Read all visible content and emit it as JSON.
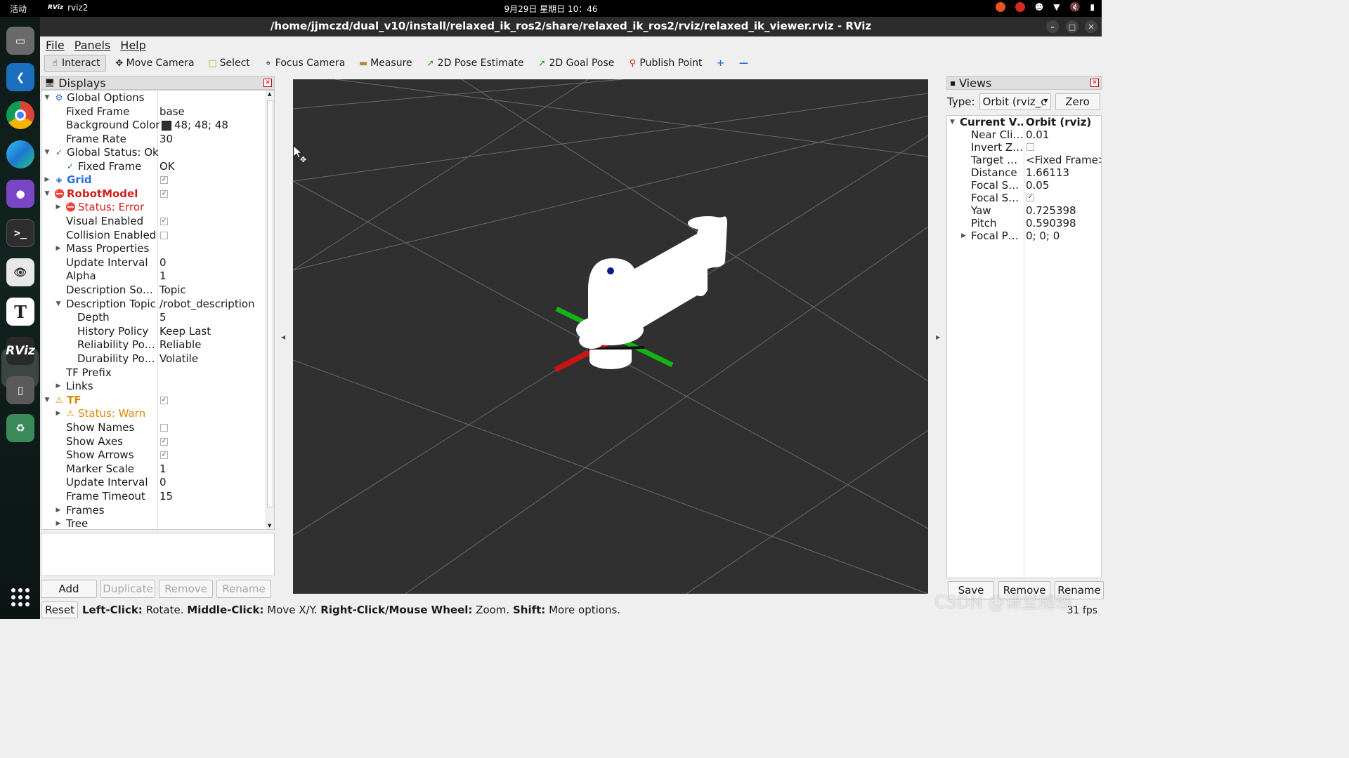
{
  "topbar": {
    "activities": "活动",
    "app_name": "rviz2",
    "app_logo": "RViz",
    "clock": "9月29日 星期日 10：46",
    "tray_icons": [
      "ubuntu-pro-icon",
      "weibo-icon",
      "accessibility-icon",
      "wifi-icon",
      "volume-muted-icon",
      "battery-icon"
    ]
  },
  "dock": {
    "apps": [
      "files-icon",
      "vscode-icon",
      "chrome-icon",
      "edge-icon",
      "github-desktop-icon",
      "terminal-icon",
      "document-viewer-icon",
      "typora-icon",
      "rviz-icon",
      "usb-drive-icon",
      "trash-icon"
    ],
    "rviz_label": "RViz",
    "typora_label": "T"
  },
  "window": {
    "title": "/home/jjmczd/dual_v10/install/relaxed_ik_ros2/share/relaxed_ik_ros2/rviz/relaxed_ik_viewer.rviz - RViz"
  },
  "menu": {
    "file": "File",
    "panels": "Panels",
    "help": "Help"
  },
  "toolbar": {
    "interact": "Interact",
    "move_camera": "Move Camera",
    "select": "Select",
    "focus_camera": "Focus Camera",
    "measure": "Measure",
    "pose_estimate": "2D Pose Estimate",
    "goal_pose": "2D Goal Pose",
    "publish_point": "Publish Point"
  },
  "displays": {
    "title": "Displays",
    "rows": [
      {
        "name": "Global Options",
        "value": ""
      },
      {
        "name": "Fixed Frame",
        "value": "base"
      },
      {
        "name": "Background Color",
        "value": "48; 48; 48"
      },
      {
        "name": "Frame Rate",
        "value": "30"
      },
      {
        "name": "Global Status: Ok",
        "value": ""
      },
      {
        "name": "Fixed Frame",
        "value": "OK"
      },
      {
        "name": "Grid",
        "value": ""
      },
      {
        "name": "RobotModel",
        "value": ""
      },
      {
        "name": "Status: Error",
        "value": ""
      },
      {
        "name": "Visual Enabled",
        "value": ""
      },
      {
        "name": "Collision Enabled",
        "value": ""
      },
      {
        "name": "Mass Properties",
        "value": ""
      },
      {
        "name": "Update Interval",
        "value": "0"
      },
      {
        "name": "Alpha",
        "value": "1"
      },
      {
        "name": "Description Sou…",
        "value": "Topic"
      },
      {
        "name": "Description Topic",
        "value": "/robot_description"
      },
      {
        "name": "Depth",
        "value": "5"
      },
      {
        "name": "History Policy",
        "value": "Keep Last"
      },
      {
        "name": "Reliability Pol…",
        "value": "Reliable"
      },
      {
        "name": "Durability Pol…",
        "value": "Volatile"
      },
      {
        "name": "TF Prefix",
        "value": ""
      },
      {
        "name": "Links",
        "value": ""
      },
      {
        "name": "TF",
        "value": ""
      },
      {
        "name": "Status: Warn",
        "value": ""
      },
      {
        "name": "Show Names",
        "value": ""
      },
      {
        "name": "Show Axes",
        "value": ""
      },
      {
        "name": "Show Arrows",
        "value": ""
      },
      {
        "name": "Marker Scale",
        "value": "1"
      },
      {
        "name": "Update Interval",
        "value": "0"
      },
      {
        "name": "Frame Timeout",
        "value": "15"
      },
      {
        "name": "Frames",
        "value": ""
      },
      {
        "name": "Tree",
        "value": ""
      }
    ],
    "checkboxes": {
      "grid": true,
      "robot_model": true,
      "visual_enabled": true,
      "collision_enabled": false,
      "tf": true,
      "show_names": false,
      "show_axes": true,
      "show_arrows": true
    },
    "background_color": "#303030",
    "buttons": {
      "add": "Add",
      "duplicate": "Duplicate",
      "remove": "Remove",
      "rename": "Rename"
    }
  },
  "views": {
    "title": "Views",
    "type_label": "Type:",
    "type_value": "Orbit (rviz_c",
    "zero": "Zero",
    "rows": [
      {
        "name": "Current V…",
        "value": "Orbit (rviz)"
      },
      {
        "name": "Near Cli…",
        "value": "0.01"
      },
      {
        "name": "Invert Z…",
        "value": ""
      },
      {
        "name": "Target …",
        "value": "<Fixed Frame>"
      },
      {
        "name": "Distance",
        "value": "1.66113"
      },
      {
        "name": "Focal S…",
        "value": "0.05"
      },
      {
        "name": "Focal S…",
        "value": ""
      },
      {
        "name": "Yaw",
        "value": "0.725398"
      },
      {
        "name": "Pitch",
        "value": "0.590398"
      },
      {
        "name": "Focal P…",
        "value": "0; 0; 0"
      }
    ],
    "checkboxes": {
      "invert_z": false,
      "focal_shape_visible": true
    },
    "buttons": {
      "save": "Save",
      "remove": "Remove",
      "rename": "Rename"
    }
  },
  "statusbar": {
    "reset": "Reset",
    "left_click_label": "Left-Click:",
    "left_click_text": "Rotate.",
    "middle_click_label": "Middle-Click:",
    "middle_click_text": "Move X/Y.",
    "right_click_label": "Right-Click/Mouse Wheel:",
    "right_click_text": "Zoom.",
    "shift_label": "Shift:",
    "shift_text": "More options.",
    "fps": "31 fps"
  },
  "watermark": "CSDN @课堂随想",
  "colors": {
    "error": "#d12020",
    "warn": "#d98a00",
    "grid_link": "#2a6fd6",
    "axis_x": "#c81414",
    "axis_y": "#14b414"
  }
}
